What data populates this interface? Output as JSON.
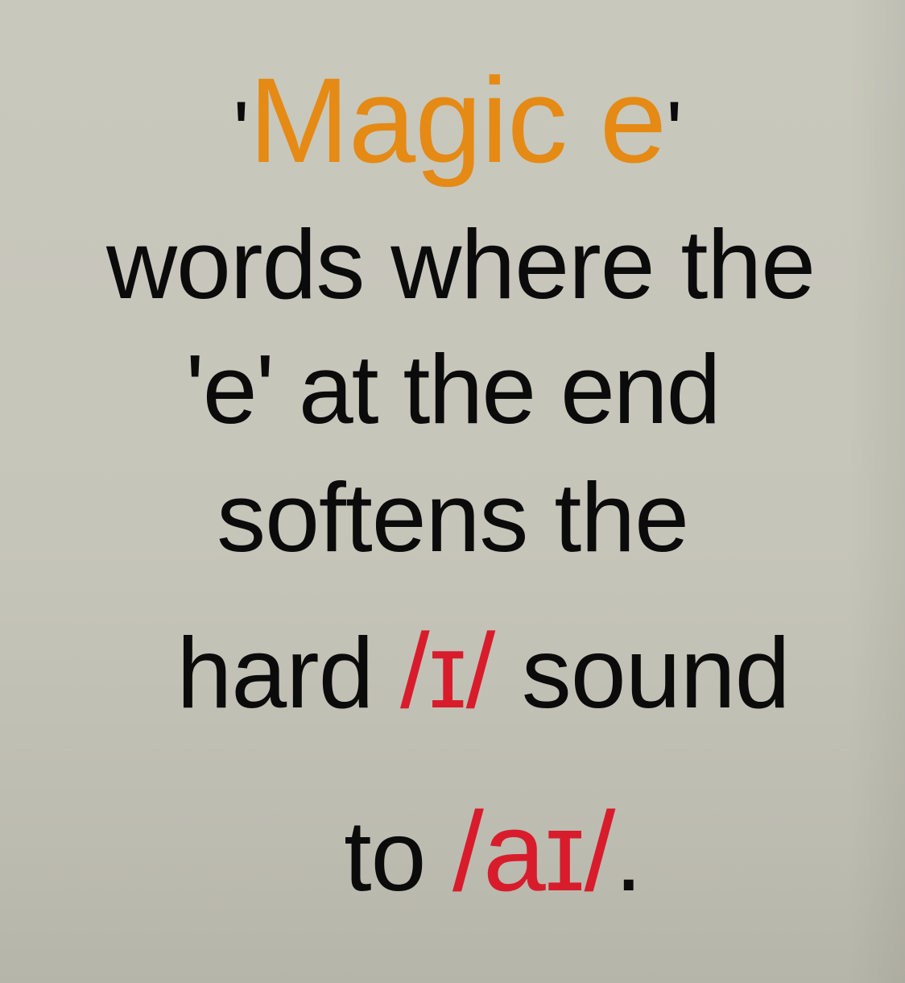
{
  "colors": {
    "background": "#c8c7bc",
    "text": "#0b0b0b",
    "title_accent": "#e58a14",
    "phoneme_accent": "#d81c2c"
  },
  "title": {
    "open_quote": "'",
    "text": "Magic e",
    "close_quote": "'"
  },
  "body_lines": [
    "words where the",
    "'e' at the end",
    "softens the"
  ],
  "hard_line": {
    "prefix": "hard ",
    "phoneme": "/ɪ/",
    "suffix": " sound"
  },
  "to_line": {
    "prefix": "to ",
    "phoneme": "/aɪ/",
    "suffix": "."
  }
}
